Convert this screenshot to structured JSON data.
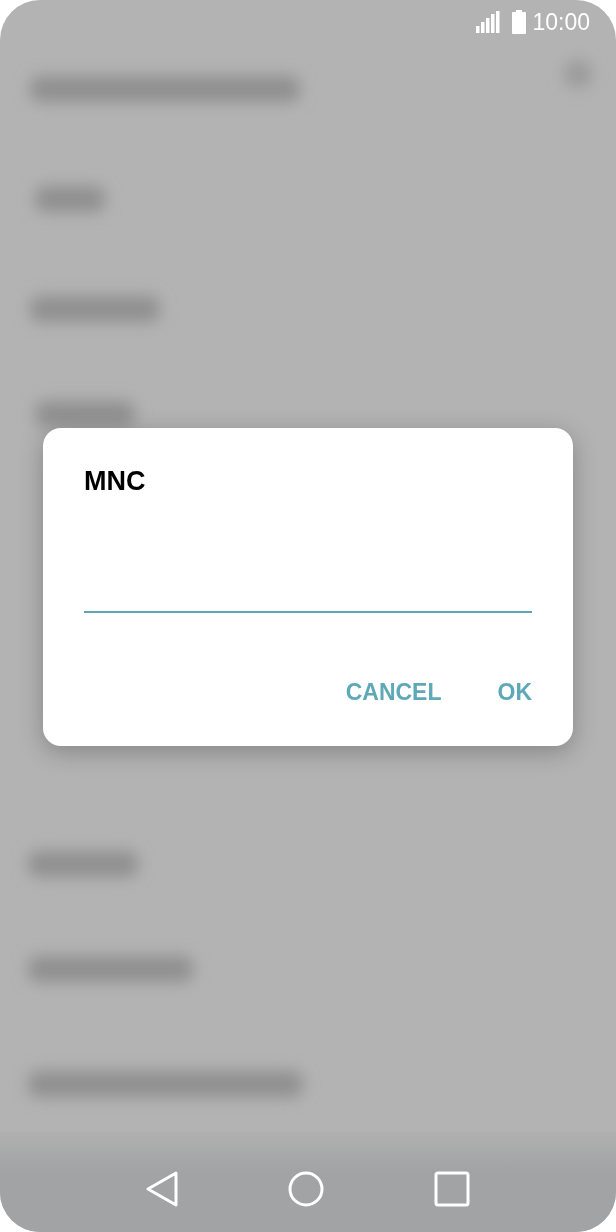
{
  "status_bar": {
    "time": "10:00"
  },
  "dialog": {
    "title": "MNC",
    "buttons": [
      {
        "label": "CANCEL"
      },
      {
        "label": "OK"
      }
    ]
  }
}
